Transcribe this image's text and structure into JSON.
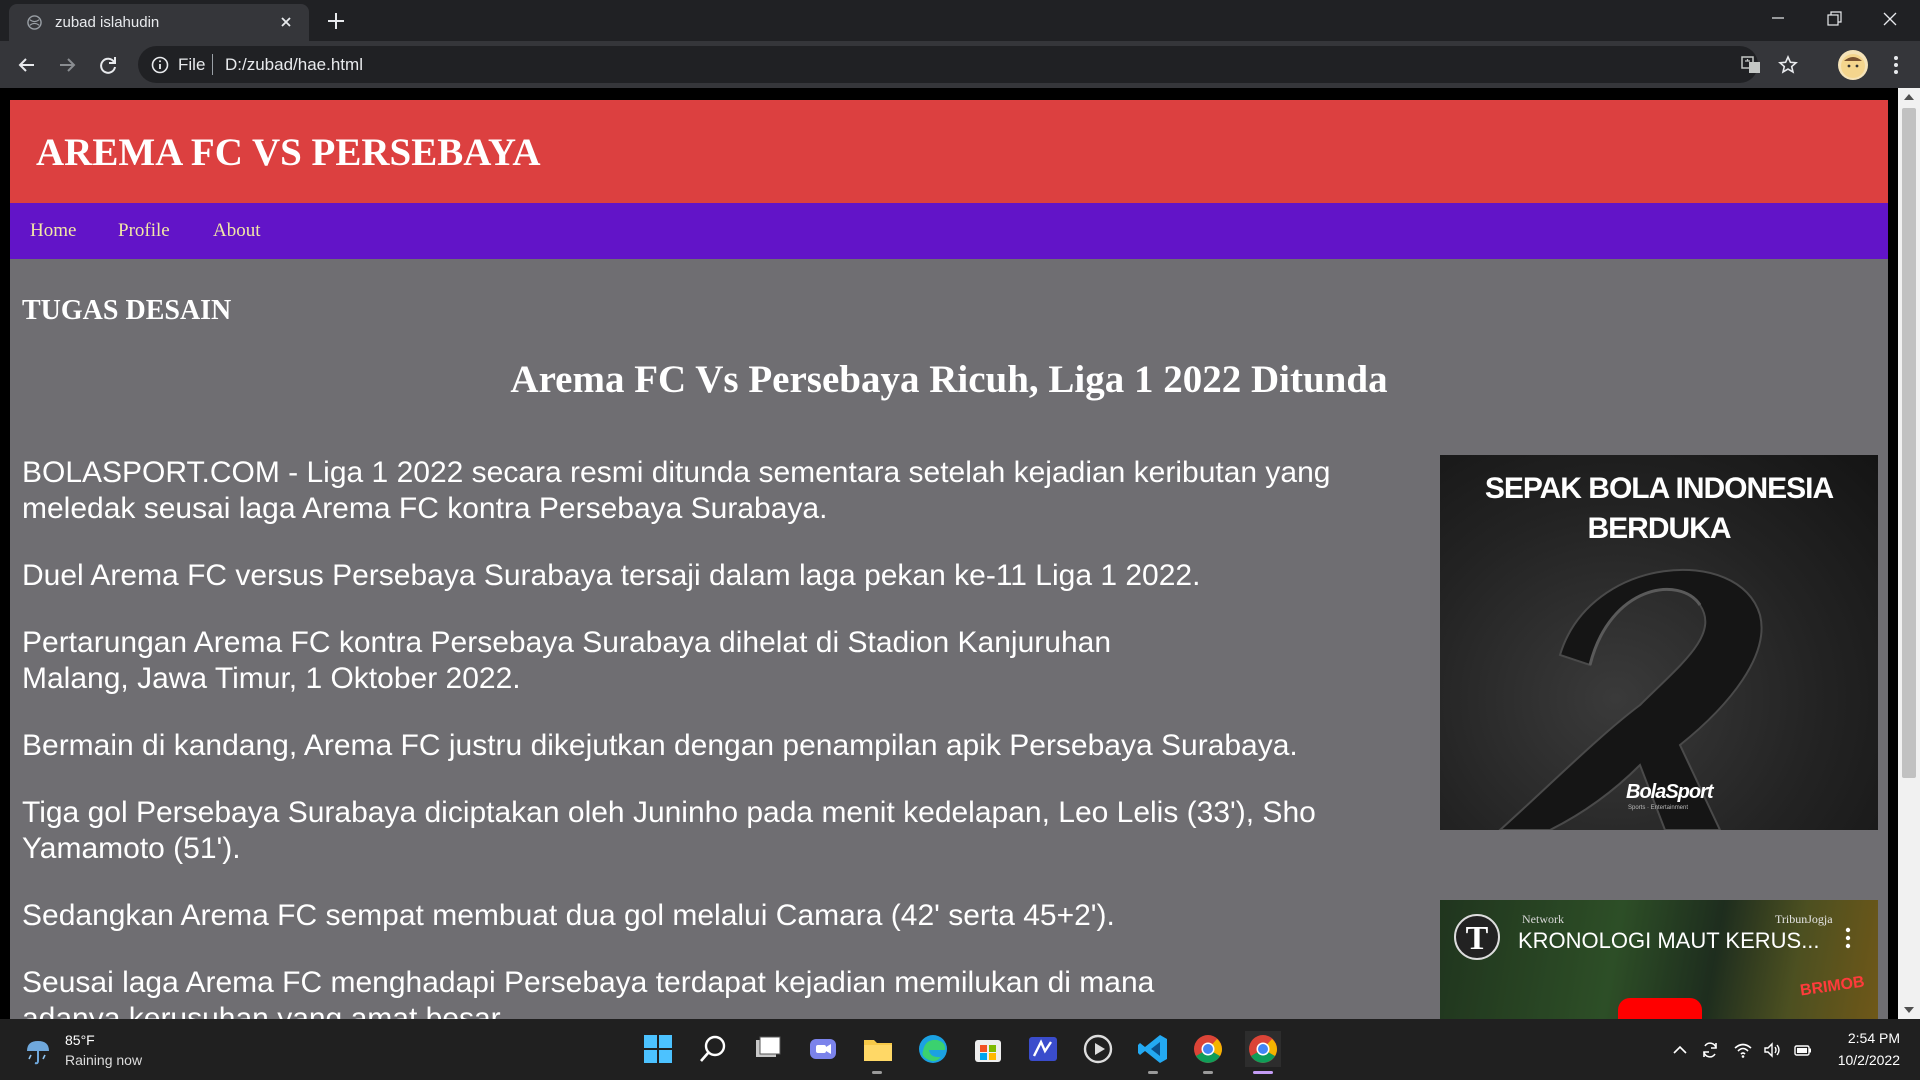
{
  "browser": {
    "tab_title": "zubad islahudin",
    "omnibox_scheme": "File",
    "url": "D:/zubad/hae.html"
  },
  "site": {
    "header_title": "AREMA FC VS PERSEBAYA",
    "nav": [
      "Home",
      "Profile",
      "About"
    ],
    "section_heading": "TUGAS DESAIN",
    "article_title": "Arema FC Vs Persebaya Ricuh, Liga 1 2022 Ditunda",
    "paragraphs": [
      "BOLASPORT.COM - Liga 1 2022 secara resmi ditunda sementara setelah kejadian keributan yang meledak seusai laga Arema FC kontra Persebaya Surabaya.",
      "Duel Arema FC versus Persebaya Surabaya tersaji dalam laga pekan ke-11 Liga 1 2022.",
      "Pertarungan Arema FC kontra Persebaya Surabaya dihelat di Stadion Kanjuruhan Malang, Jawa Timur, 1 Oktober 2022.",
      "Bermain di kandang, Arema FC justru dikejutkan dengan penampilan apik Persebaya Surabaya.",
      "Tiga gol Persebaya Surabaya diciptakan oleh Juninho pada menit kedelapan, Leo Lelis (33'), Sho Yamamoto (51').",
      "Sedangkan Arema FC sempat membuat dua gol melalui Camara (42' serta 45+2').",
      "Seusai laga Arema FC menghadapi Persebaya terdapat kejadian memilukan di mana adanya kerusuhan yang amat besar."
    ],
    "side_image": {
      "line1": "SEPAK BOLA INDONESIA",
      "line2": "BERDUKA",
      "brand": "BolaSport",
      "tagline": "Sports · Entertainment"
    },
    "video": {
      "logo_letter": "T",
      "title": "KRONOLOGI MAUT KERUS...",
      "corner_left": "Network",
      "corner_right": "TribunJogja",
      "overlay": "BRIMOB"
    }
  },
  "taskbar": {
    "weather_temp": "85°F",
    "weather_desc": "Raining now",
    "time": "2:54 PM",
    "date": "10/2/2022"
  },
  "colors": {
    "header_red": "#dc4040",
    "nav_purple": "#6214c8",
    "nav_link": "#f1e7a6",
    "page_gray": "#6f6e72"
  }
}
